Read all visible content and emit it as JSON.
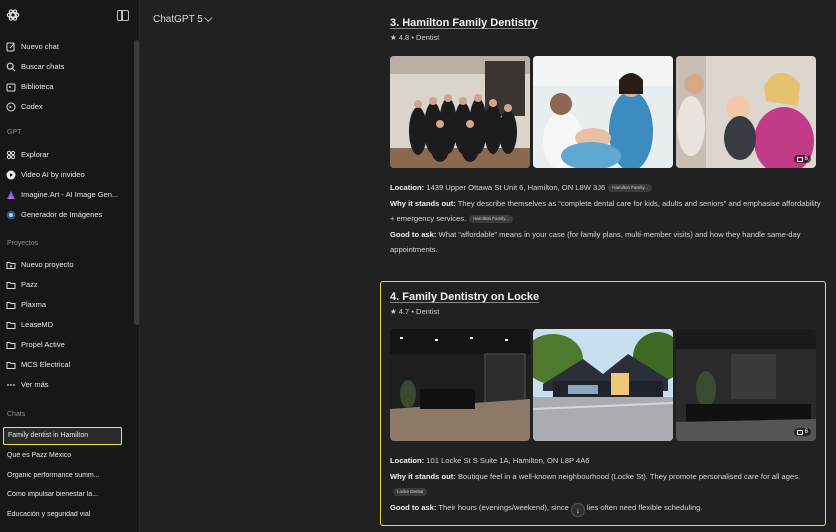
{
  "sidebar": {
    "top_items": [
      {
        "label": "Nuevo chat",
        "icon": "edit-icon"
      },
      {
        "label": "Buscar chats",
        "icon": "search-icon"
      },
      {
        "label": "Biblioteca",
        "icon": "library-icon"
      },
      {
        "label": "Codex",
        "icon": "codex-icon"
      }
    ],
    "gpt_heading": "GPT",
    "gpt_items": [
      {
        "label": "Explorar",
        "icon": "grid-icon"
      },
      {
        "label": "Video AI by invideo",
        "icon": "video-ai-icon"
      },
      {
        "label": "Imagine.Art - AI Image Gen...",
        "icon": "imagine-art-icon"
      },
      {
        "label": "Generador de Imágenes",
        "icon": "image-generator-icon"
      }
    ],
    "projects_heading": "Proyectos",
    "project_items": [
      {
        "label": "Nuevo proyecto",
        "icon": "new-folder-icon"
      },
      {
        "label": "Pazz",
        "icon": "folder-icon"
      },
      {
        "label": "Plaxma",
        "icon": "folder-icon"
      },
      {
        "label": "LeaseMD",
        "icon": "folder-icon"
      },
      {
        "label": "Propel Active",
        "icon": "folder-icon"
      },
      {
        "label": "MCS Electrical",
        "icon": "folder-icon"
      },
      {
        "label": "Ver más",
        "icon": "more-icon"
      }
    ],
    "chats_heading": "Chats",
    "chats": [
      "Family dentist in Hamilton",
      "Qué es Pazz México",
      "Organic performance summ...",
      "Cómo impulsar bienestar la...",
      "Educación y seguridad vial"
    ]
  },
  "header": {
    "model_label": "ChatGPT 5"
  },
  "result3": {
    "title": "3. Hamilton Family Dentistry",
    "rating": "★ 4.8 • Dentist",
    "photo_count": "6",
    "location_label": "Location:",
    "location": "1439 Upper Ottawa St Unit 6, Hamilton, ON L8W 3J6",
    "location_chip": "Hamilton Family...",
    "why_label": "Why it stands out:",
    "why": "They describe themselves as “complete dental care for kids, adults and seniors” and emphasise affordability + emergency services.",
    "why_chip": "Hamilton Family...",
    "ask_label": "Good to ask:",
    "ask": "What “affordable” means in your case (for family plans, multi-member visits) and how they handle same-day appointments."
  },
  "result4": {
    "title": "4. Family Dentistry on Locke",
    "rating": "★ 4.7 • Dentist",
    "photo_count": "6",
    "location_label": "Location:",
    "location": "101 Locke St S Suite 1A, Hamilton, ON L8P 4A6",
    "why_label": "Why it stands out:",
    "why": "Boutique feel in a well-known neighbourhood (Locke St). They promote personalised care for all ages.",
    "why_chip": "Locke Dental",
    "ask_label": "Good to ask:",
    "ask_a": "Their hours (evenings/weekend), since",
    "ask_b": "lies often need flexible scheduling."
  },
  "colors": {
    "highlight": "#e8d93b",
    "background": "#212121",
    "sidebar": "#171717"
  }
}
